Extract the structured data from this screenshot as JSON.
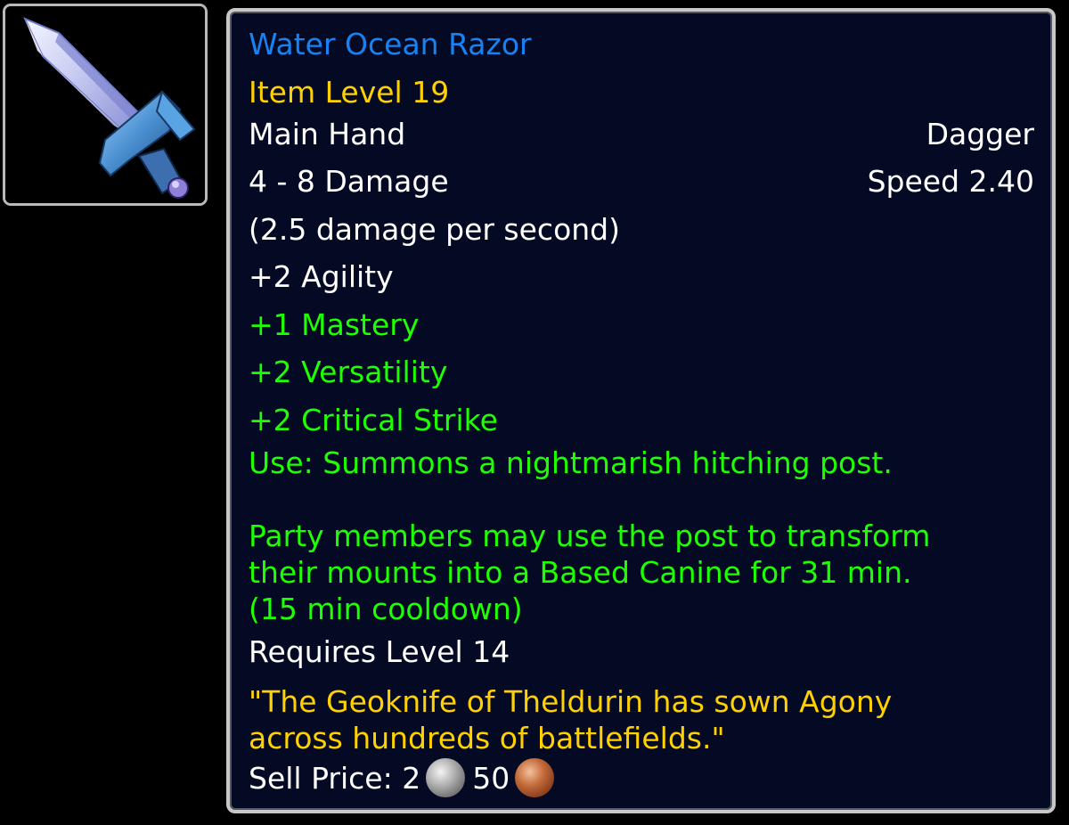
{
  "item": {
    "name": "Water Ocean Razor",
    "item_level": "Item Level 19",
    "slot": "Main Hand",
    "type": "Dagger",
    "damage": "4 - 8 Damage",
    "speed": "Speed 2.40",
    "dps": "(2.5 damage per second)",
    "stats": {
      "agility": "+2 Agility",
      "mastery": "+1 Mastery",
      "versatility": "+2 Versatility",
      "critical_strike": "+2 Critical Strike"
    },
    "use_effect": "Use: Summons a nightmarish hitching post.\n\nParty members may use the post to transform\ntheir mounts into a Based Canine for 31 min.\n(15 min cooldown)",
    "requirement": "Requires Level 14",
    "flavor_text": "\"The Geoknife of Theldurin has sown Agony\nacross hundreds of battlefields.\"",
    "sell_price": {
      "label": "Sell Price:",
      "silver": "2",
      "copper": "50"
    },
    "icon": "dagger-icon"
  },
  "colors": {
    "name_quality": "#1782f2",
    "item_level": "#ffd100",
    "secondary_stat": "#1eff00",
    "flavor": "#ffd100",
    "tooltip_bg": "#050a24"
  }
}
